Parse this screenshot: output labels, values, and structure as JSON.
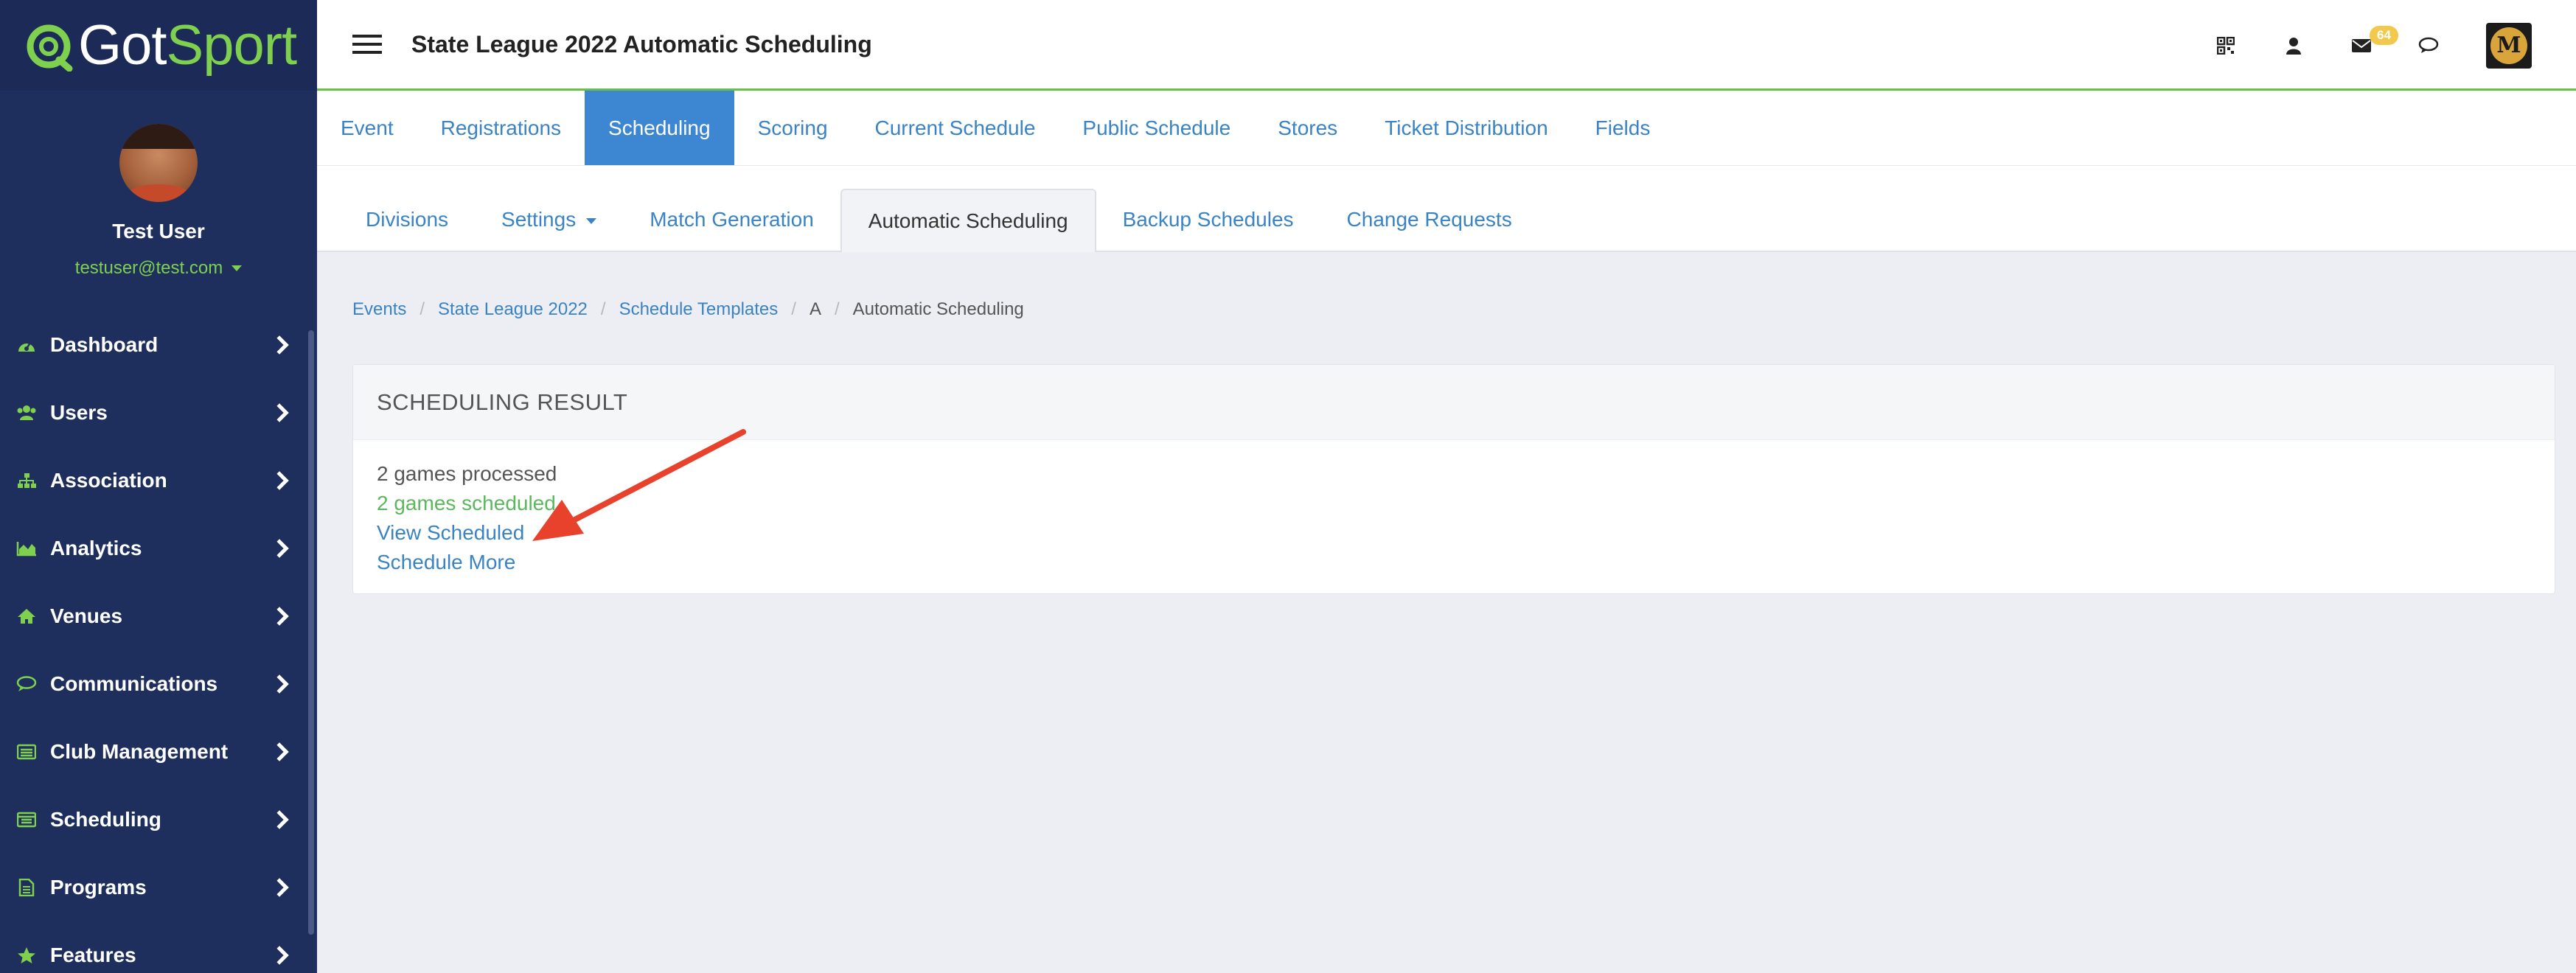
{
  "brand": {
    "logo_text_part1": "Got",
    "logo_text_part2": "Sport"
  },
  "profile": {
    "name": "Test User",
    "email": "testuser@test.com"
  },
  "sidebar": {
    "items": [
      {
        "label": "Dashboard",
        "icon": "dashboard-icon"
      },
      {
        "label": "Users",
        "icon": "users-icon"
      },
      {
        "label": "Association",
        "icon": "sitemap-icon"
      },
      {
        "label": "Analytics",
        "icon": "area-chart-icon"
      },
      {
        "label": "Venues",
        "icon": "home-icon"
      },
      {
        "label": "Communications",
        "icon": "chat-icon"
      },
      {
        "label": "Club Management",
        "icon": "list-icon"
      },
      {
        "label": "Scheduling",
        "icon": "calendar-list-icon"
      },
      {
        "label": "Programs",
        "icon": "document-icon"
      },
      {
        "label": "Features",
        "icon": "star-icon"
      }
    ]
  },
  "header": {
    "title": "State League 2022 Automatic Scheduling",
    "mail_badge": "64"
  },
  "primary_tabs": [
    {
      "label": "Event",
      "active": false
    },
    {
      "label": "Registrations",
      "active": false
    },
    {
      "label": "Scheduling",
      "active": true
    },
    {
      "label": "Scoring",
      "active": false
    },
    {
      "label": "Current Schedule",
      "active": false
    },
    {
      "label": "Public Schedule",
      "active": false
    },
    {
      "label": "Stores",
      "active": false
    },
    {
      "label": "Ticket Distribution",
      "active": false
    },
    {
      "label": "Fields",
      "active": false
    }
  ],
  "secondary_tabs": [
    {
      "label": "Divisions",
      "active": false
    },
    {
      "label": "Settings",
      "active": false
    },
    {
      "label": "Match Generation",
      "active": false
    },
    {
      "label": "Automatic Scheduling",
      "active": true
    },
    {
      "label": "Backup Schedules",
      "active": false
    },
    {
      "label": "Change Requests",
      "active": false
    }
  ],
  "breadcrumb": {
    "items": [
      "Events",
      "State League 2022",
      "Schedule Templates",
      "A",
      "Automatic Scheduling"
    ]
  },
  "result": {
    "heading": "SCHEDULING RESULT",
    "processed": "2 games processed",
    "scheduled": "2 games scheduled",
    "view_link": "View Scheduled",
    "more_link": "Schedule More"
  },
  "colors": {
    "sidebar_bg": "#1e2f5e",
    "accent_green": "#7fd04e",
    "link_blue": "#3a83c4",
    "active_tab_blue": "#3d86d1",
    "success_green": "#5cb85c",
    "annotation_red": "#e8412c"
  }
}
